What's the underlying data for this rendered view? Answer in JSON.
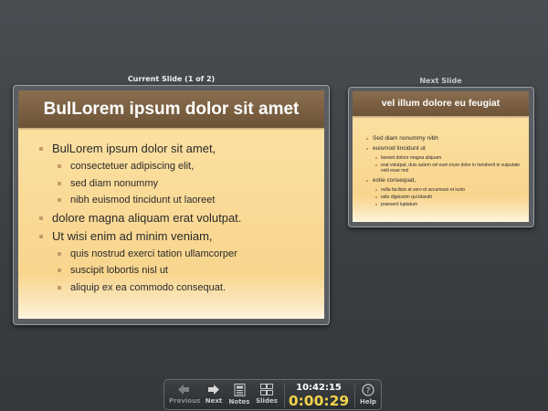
{
  "current": {
    "caption": "Current Slide (1 of 2)",
    "title": "BulLorem ipsum dolor sit amet",
    "bullets": [
      {
        "level": 1,
        "text": "BulLorem ipsum dolor sit amet,"
      },
      {
        "level": 2,
        "text": "consectetuer adipiscing elit,"
      },
      {
        "level": 2,
        "text": "sed diam nonummy"
      },
      {
        "level": 2,
        "text": "nibh euismod tincidunt ut laoreet"
      },
      {
        "level": 1,
        "text": "dolore magna aliquam erat volutpat."
      },
      {
        "level": 1,
        "text": "Ut wisi enim ad minim veniam,"
      },
      {
        "level": 2,
        "text": "quis nostrud exerci tation ullamcorper"
      },
      {
        "level": 2,
        "text": "suscipit lobortis nisl ut"
      },
      {
        "level": 2,
        "text": "aliquip ex ea commodo consequat."
      }
    ]
  },
  "next": {
    "caption": "Next Slide",
    "title": "vel illum dolore eu feugiat",
    "bullets": [
      {
        "level": 1,
        "text": "Sed diam nonummy nibh"
      },
      {
        "level": 1,
        "text": "euismod tincidunt ut"
      },
      {
        "level": 2,
        "text": "laoreet dolore magna aliquam"
      },
      {
        "level": 2,
        "text": "erat volutpat, duis autem vel eum iriure dolor in hendrerit in vulputate velit esse mol"
      },
      {
        "level": 1,
        "text": "estie consequat,"
      },
      {
        "level": 2,
        "text": "nulla facilisis at vero et accumsan et iusto"
      },
      {
        "level": 2,
        "text": "odio dignissim qui blandit"
      },
      {
        "level": 2,
        "text": "praesent luptatum"
      }
    ]
  },
  "toolbar": {
    "previous_label": "Previous",
    "next_label": "Next",
    "notes_label": "Notes",
    "slides_label": "Slides",
    "clock_time": "10:42:15",
    "elapsed_time": "0:00:29",
    "help_label": "Help",
    "previous_enabled": false
  },
  "colors": {
    "title_bar": "#7a5f42",
    "slide_background": "#f9d58e",
    "bullet": "#c89a68",
    "elapsed_time": "#f2d34b"
  },
  "icons": [
    "previous-arrow-icon",
    "next-arrow-icon",
    "notes-icon",
    "slides-grid-icon",
    "help-icon"
  ]
}
